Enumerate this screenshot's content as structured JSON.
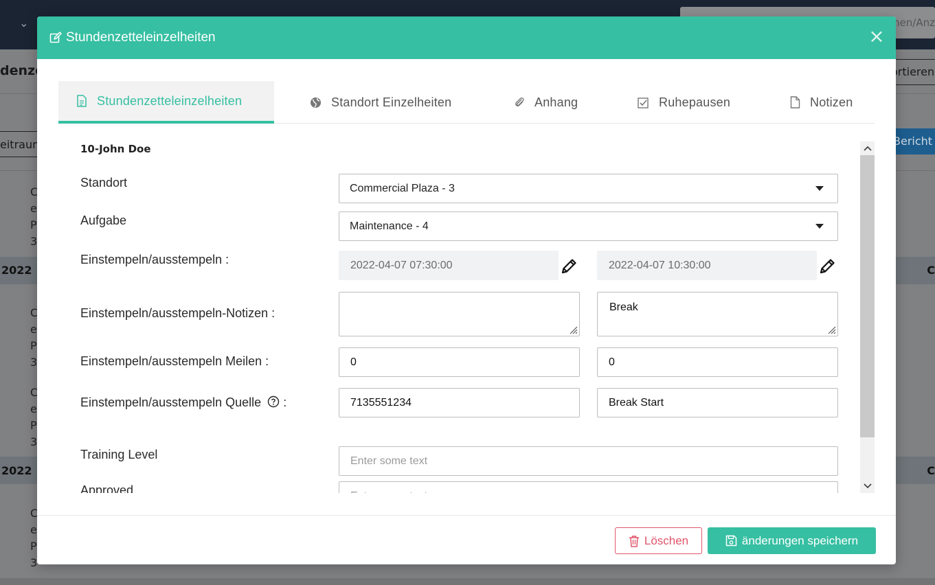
{
  "background": {
    "search_text": "hnen/Anz",
    "page_title": "denze",
    "sort_label": "ortieren",
    "range_label": "eitraum",
    "report_label": "Bericht",
    "band_label": "2022",
    "band_right": "C",
    "letters": [
      "C",
      "e",
      "P",
      "3"
    ],
    "pause_text": "Pause"
  },
  "modal": {
    "title": "Stundenzetteleinzelheiten",
    "close_glyph": "×",
    "tabs": [
      {
        "label": "Stundenzetteleinzelheiten",
        "icon": "document-icon",
        "active": true
      },
      {
        "label": "Standort Einzelheiten",
        "icon": "globe-icon",
        "active": false
      },
      {
        "label": "Anhang",
        "icon": "paperclip-icon",
        "active": false
      },
      {
        "label": "Ruhepausen",
        "icon": "checkbox-icon",
        "active": false
      },
      {
        "label": "Notizen",
        "icon": "file-icon",
        "active": false
      }
    ],
    "person": "10-John Doe",
    "fields": {
      "standort_label": "Standort",
      "standort_value": "Commercial Plaza - 3",
      "aufgabe_label": "Aufgabe",
      "aufgabe_value": "Maintenance - 4",
      "clock_label": "Einstempeln/ausstempeln :",
      "clock_in": "2022-04-07 07:30:00",
      "clock_out": "2022-04-07 10:30:00",
      "notes_label": "Einstempeln/ausstempeln-Notizen :",
      "notes_in": "",
      "notes_out": "Break",
      "miles_label": "Einstempeln/ausstempeln Meilen :",
      "miles_in": "0",
      "miles_out": "0",
      "source_label": "Einstempeln/ausstempeln Quelle",
      "source_suffix": ":",
      "source_in": "7135551234",
      "source_out": "Break Start",
      "training_label": "Training Level",
      "training_placeholder": "Enter some text",
      "approved_label": "Approved",
      "approved_placeholder": "Enter some text"
    },
    "footer": {
      "delete_label": "Löschen",
      "save_label": "änderungen speichern"
    }
  },
  "colors": {
    "accent": "#36bfa2",
    "danger": "#e0556a"
  }
}
